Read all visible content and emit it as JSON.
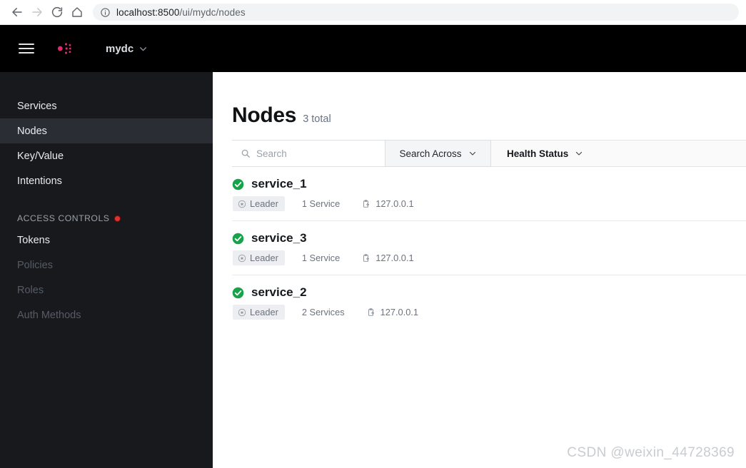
{
  "browser": {
    "back_icon": "arrow-left-icon",
    "forward_icon": "arrow-right-icon",
    "reload_icon": "reload-icon",
    "home_icon": "home-icon",
    "info_icon": "info-circle-icon",
    "url_host": "localhost:8500",
    "url_path": "/ui/mydc/nodes"
  },
  "header": {
    "menu_icon": "hamburger-menu-icon",
    "logo_icon": "consul-logo-icon",
    "datacenter": "mydc",
    "datacenter_chevron": "chevron-down-icon"
  },
  "sidebar": {
    "items": [
      {
        "label": "Services",
        "active": false,
        "muted": false
      },
      {
        "label": "Nodes",
        "active": true,
        "muted": false
      },
      {
        "label": "Key/Value",
        "active": false,
        "muted": false
      },
      {
        "label": "Intentions",
        "active": false,
        "muted": false
      }
    ],
    "section_label": "ACCESS CONTROLS",
    "section_badge": "red-dot-badge",
    "acl_items": [
      {
        "label": "Tokens",
        "muted": false
      },
      {
        "label": "Policies",
        "muted": true
      },
      {
        "label": "Roles",
        "muted": true
      },
      {
        "label": "Auth Methods",
        "muted": true
      }
    ]
  },
  "main": {
    "title": "Nodes",
    "count_label": "3 total",
    "filters": {
      "search_icon": "search-icon",
      "search_placeholder": "Search",
      "search_value": "",
      "search_across_label": "Search Across",
      "search_across_chevron": "chevron-down-icon",
      "health_status_label": "Health Status",
      "health_status_chevron": "chevron-down-icon"
    },
    "nodes": [
      {
        "name": "service_1",
        "status_icon": "check-circle-icon",
        "leader_icon": "star-circle-icon",
        "leader_label": "Leader",
        "services_label": "1 Service",
        "copy_icon": "copy-clipboard-icon",
        "address": "127.0.0.1"
      },
      {
        "name": "service_3",
        "status_icon": "check-circle-icon",
        "leader_icon": "star-circle-icon",
        "leader_label": "Leader",
        "services_label": "1 Service",
        "copy_icon": "copy-clipboard-icon",
        "address": "127.0.0.1"
      },
      {
        "name": "service_2",
        "status_icon": "check-circle-icon",
        "leader_icon": "star-circle-icon",
        "leader_label": "Leader",
        "services_label": "2 Services",
        "copy_icon": "copy-clipboard-icon",
        "address": "127.0.0.1"
      }
    ]
  },
  "watermark": "CSDN @weixin_44728369",
  "colors": {
    "brand_pink": "#dc2b6c",
    "header_black": "#000000",
    "sidebar_dark": "#17191c",
    "sidebar_active": "#2a2d33",
    "status_green": "#16a34a",
    "badge_red": "#e03131"
  }
}
